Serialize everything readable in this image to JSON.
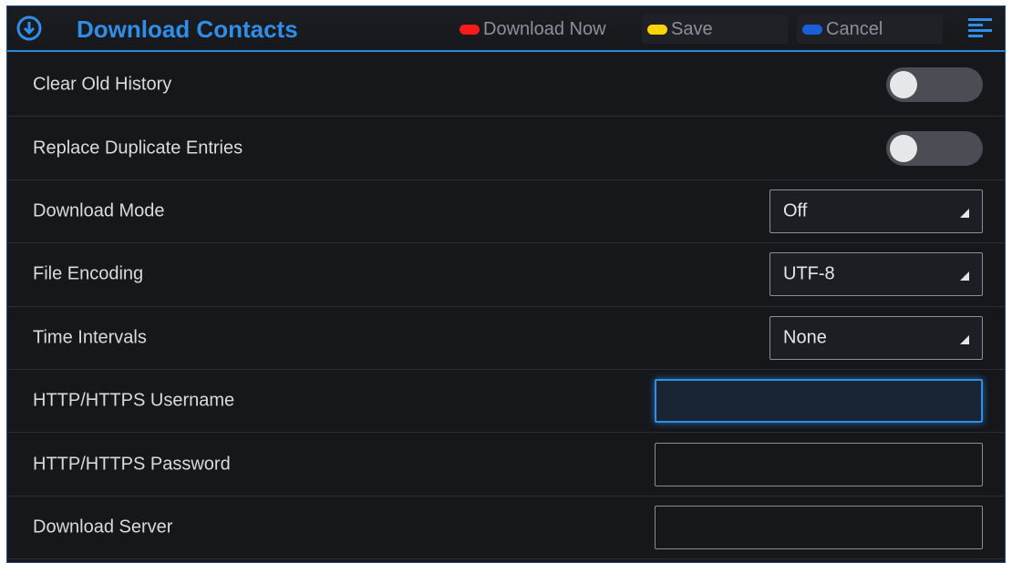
{
  "header": {
    "title": "Download Contacts",
    "softkeys": {
      "download_now": "Download Now",
      "save": "Save",
      "cancel": "Cancel"
    },
    "icons": {
      "title": "download-circle-icon",
      "menu": "menu-icon"
    },
    "colors": {
      "accent": "#2f8ee8",
      "download_now_key": "#ff1a1a",
      "save_key": "#ffd400",
      "cancel_key": "#1a5fd8"
    }
  },
  "settings": {
    "clear_old_history": {
      "label": "Clear Old History",
      "enabled": false
    },
    "replace_duplicate_entries": {
      "label": "Replace Duplicate Entries",
      "enabled": false
    },
    "download_mode": {
      "label": "Download Mode",
      "value": "Off"
    },
    "file_encoding": {
      "label": "File Encoding",
      "value": "UTF-8"
    },
    "time_intervals": {
      "label": "Time Intervals",
      "value": "None"
    },
    "http_username": {
      "label": "HTTP/HTTPS Username",
      "value": "",
      "focused": true
    },
    "http_password": {
      "label": "HTTP/HTTPS Password",
      "value": ""
    },
    "download_server": {
      "label": "Download Server",
      "value": ""
    }
  }
}
